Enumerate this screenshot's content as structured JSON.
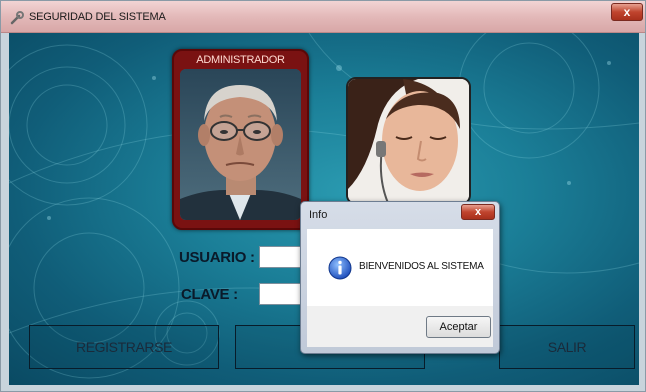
{
  "window": {
    "title": "SEGURIDAD DEL SISTEMA",
    "close_glyph": "x",
    "icon": "wrench-icon"
  },
  "profiles": {
    "admin_label": "ADMINISTRADOR"
  },
  "form": {
    "usuario_label": "USUARIO :",
    "usuario_value": "",
    "clave_label": "CLAVE :",
    "clave_value": ""
  },
  "buttons": {
    "registrarse": "REGISTRARSE",
    "ingresar": "",
    "salir": "SALIR"
  },
  "dialog": {
    "title": "Info",
    "close_glyph": "x",
    "message": "BIENVENIDOS AL SISTEMA",
    "accept": "Aceptar",
    "icon": "info-icon"
  },
  "colors": {
    "background": "#1b7f98",
    "admin_frame": "#7a1212",
    "titlebar": "#e3b9b9"
  }
}
